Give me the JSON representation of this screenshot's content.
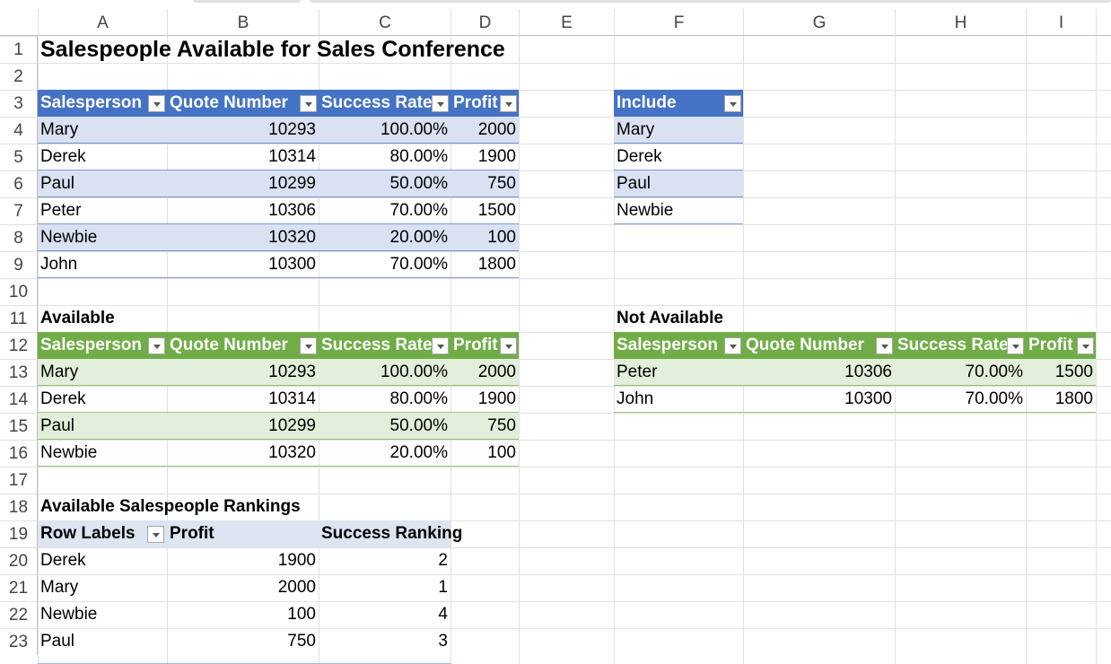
{
  "columns": [
    "A",
    "B",
    "C",
    "D",
    "E",
    "F",
    "G",
    "H",
    "I"
  ],
  "rows": [
    "1",
    "2",
    "3",
    "4",
    "5",
    "6",
    "7",
    "8",
    "9",
    "10",
    "11",
    "12",
    "13",
    "14",
    "15",
    "16",
    "17",
    "18",
    "19",
    "20",
    "21",
    "22",
    "23"
  ],
  "title": "Salespeople Available for Sales Conference",
  "table_headers": [
    "Salesperson",
    "Quote Number",
    "Success Rate",
    "Profit"
  ],
  "main_table": [
    [
      "Mary",
      "10293",
      "100.00%",
      "2000"
    ],
    [
      "Derek",
      "10314",
      "80.00%",
      "1900"
    ],
    [
      "Paul",
      "10299",
      "50.00%",
      "750"
    ],
    [
      "Peter",
      "10306",
      "70.00%",
      "1500"
    ],
    [
      "Newbie",
      "10320",
      "20.00%",
      "100"
    ],
    [
      "John",
      "10300",
      "70.00%",
      "1800"
    ]
  ],
  "include": {
    "header": "Include",
    "items": [
      "Mary",
      "Derek",
      "Paul",
      "Newbie"
    ]
  },
  "available": {
    "label": "Available",
    "rows": [
      [
        "Mary",
        "10293",
        "100.00%",
        "2000"
      ],
      [
        "Derek",
        "10314",
        "80.00%",
        "1900"
      ],
      [
        "Paul",
        "10299",
        "50.00%",
        "750"
      ],
      [
        "Newbie",
        "10320",
        "20.00%",
        "100"
      ]
    ]
  },
  "not_available": {
    "label": "Not Available",
    "rows": [
      [
        "Peter",
        "10306",
        "70.00%",
        "1500"
      ],
      [
        "John",
        "10300",
        "70.00%",
        "1800"
      ]
    ]
  },
  "pivot": {
    "label": "Available Salespeople Rankings",
    "headers": [
      "Row Labels",
      "Profit",
      "Success Ranking"
    ],
    "rows": [
      [
        "Derek",
        "1900",
        "2"
      ],
      [
        "Mary",
        "2000",
        "1"
      ],
      [
        "Newbie",
        "100",
        "4"
      ],
      [
        "Paul",
        "750",
        "3"
      ]
    ]
  },
  "colors": {
    "blue_header": "#4472c4",
    "blue_band": "#d9e1f2",
    "green_header": "#70ad47",
    "green_band": "#e2efda",
    "pivot_header": "#dde4f2"
  }
}
